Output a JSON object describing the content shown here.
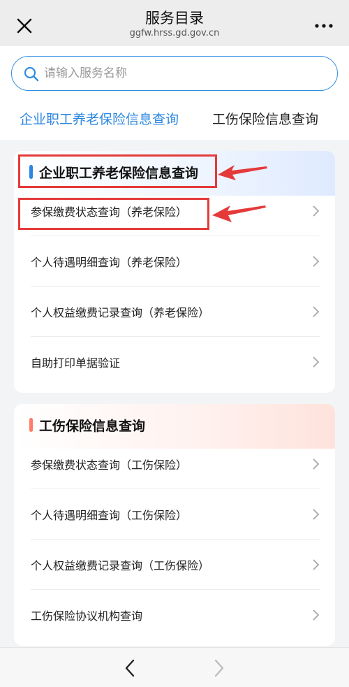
{
  "header": {
    "title": "服务目录",
    "subtitle": "ggfw.hrss.gd.gov.cn"
  },
  "search": {
    "placeholder": "请输入服务名称",
    "value": ""
  },
  "tabs": [
    {
      "label": "企业职工养老保险信息查询",
      "active": true
    },
    {
      "label": "工伤保险信息查询",
      "active": false
    }
  ],
  "sections": [
    {
      "title": "企业职工养老保险信息查询",
      "accent_color": "#2a86e0",
      "items": [
        {
          "label": "参保缴费状态查询（养老保险）"
        },
        {
          "label": "个人待遇明细查询（养老保险）"
        },
        {
          "label": "个人权益缴费记录查询（养老保险）"
        },
        {
          "label": "自助打印单据验证"
        }
      ]
    },
    {
      "title": "工伤保险信息查询",
      "accent_color": "#ff7b6b",
      "items": [
        {
          "label": "参保缴费状态查询（工伤保险）"
        },
        {
          "label": "个人待遇明细查询（工伤保险）"
        },
        {
          "label": "个人权益缴费记录查询（工伤保险）"
        },
        {
          "label": "工伤保险协议机构查询"
        }
      ]
    }
  ],
  "annotations": {
    "color": "#e43a3a"
  },
  "colors": {
    "accent_blue": "#2a86e0",
    "accent_red": "#ff7b6b",
    "annotation_red": "#e43a3a"
  },
  "icons": {
    "close": "close-icon",
    "more": "more-icon",
    "search": "search-icon",
    "chevron": "chevron-right-icon",
    "back": "chevron-left-icon",
    "forward": "chevron-right-icon"
  }
}
